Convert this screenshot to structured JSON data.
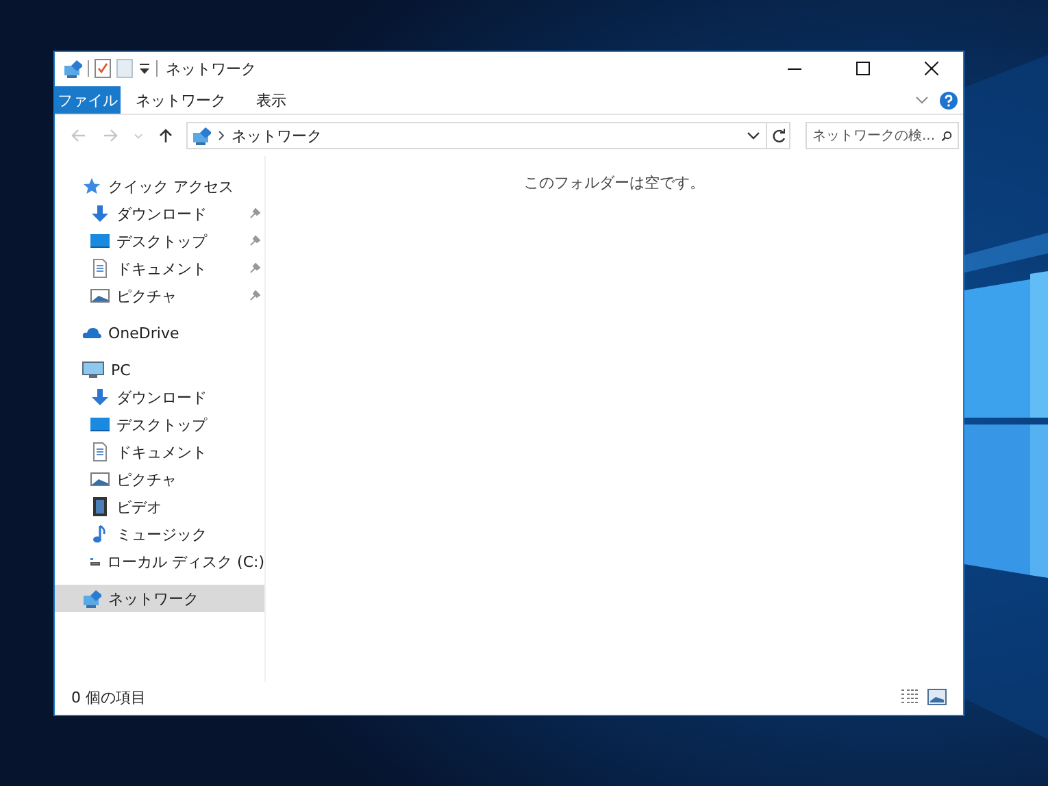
{
  "window": {
    "title": "ネットワーク"
  },
  "ribbon": {
    "tabs": [
      {
        "label": "ファイル",
        "kind": "file"
      },
      {
        "label": "ネットワーク",
        "kind": "tab"
      },
      {
        "label": "表示",
        "kind": "tab"
      }
    ]
  },
  "address_bar": {
    "location": "ネットワーク"
  },
  "search": {
    "placeholder": "ネットワークの検..."
  },
  "navigation": [
    {
      "label": "クイック アクセス",
      "kind": "star",
      "selected": false,
      "children": [
        {
          "label": "ダウンロード",
          "kind": "download",
          "pinned": true,
          "selected": false
        },
        {
          "label": "デスクトップ",
          "kind": "desktop",
          "pinned": true,
          "selected": false
        },
        {
          "label": "ドキュメント",
          "kind": "document",
          "pinned": true,
          "selected": false
        },
        {
          "label": "ピクチャ",
          "kind": "pictures",
          "pinned": true,
          "selected": false
        }
      ]
    },
    {
      "label": "OneDrive",
      "kind": "cloud",
      "selected": false
    },
    {
      "label": "PC",
      "kind": "pc",
      "selected": false,
      "children": [
        {
          "label": "ダウンロード",
          "kind": "download",
          "pinned": false,
          "selected": false
        },
        {
          "label": "デスクトップ",
          "kind": "desktop",
          "pinned": false,
          "selected": false
        },
        {
          "label": "ドキュメント",
          "kind": "document",
          "pinned": false,
          "selected": false
        },
        {
          "label": "ピクチャ",
          "kind": "pictures",
          "pinned": false,
          "selected": false
        },
        {
          "label": "ビデオ",
          "kind": "video",
          "pinned": false,
          "selected": false
        },
        {
          "label": "ミュージック",
          "kind": "music",
          "pinned": false,
          "selected": false
        },
        {
          "label": "ローカル ディスク (C:)",
          "kind": "disk",
          "pinned": false,
          "selected": false
        }
      ]
    },
    {
      "label": "ネットワーク",
      "kind": "network",
      "selected": true
    }
  ],
  "content": {
    "empty_message": "このフォルダーは空です。"
  },
  "status_bar": {
    "item_count": "0 個の項目"
  }
}
